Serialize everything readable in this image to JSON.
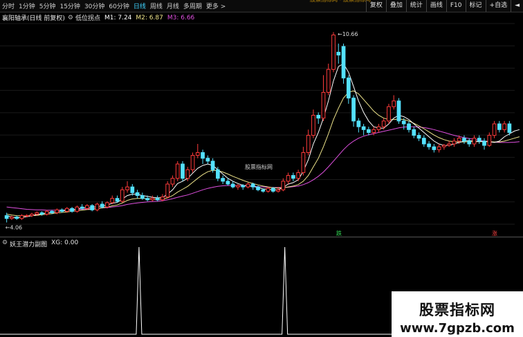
{
  "toolbar": {
    "periods": [
      "分时",
      "1分钟",
      "5分钟",
      "15分钟",
      "30分钟",
      "60分钟",
      "日线",
      "周线",
      "月线",
      "多周期",
      "更多 >"
    ],
    "active_period": "日线",
    "title": "股票指标网 - 股票指标网",
    "right_buttons": [
      "复权",
      "叠加",
      "统计",
      "画线",
      "F10",
      "标记",
      "+自选",
      "◄"
    ]
  },
  "main_legend": {
    "stock_name": "襄阳轴承(日线 前复权)",
    "indicator_name": "低位拐点",
    "m1": "M1: 7.24",
    "m2": "M2: 6.87",
    "m3": "M3: 6.66"
  },
  "sub_legend": {
    "indicator_name": "妖王潜力副图",
    "xg": "XG: 0.00"
  },
  "annotations": {
    "high_label": "10.66",
    "low_label": "4.06",
    "signal_mark_1": "跌",
    "signal_mark_2": "涨"
  },
  "watermark": {
    "mid": "股票指标网",
    "line1": "股票指标网",
    "line2": "www.7gpzb.com"
  },
  "colors": {
    "up": "#ff3b3b",
    "down": "#54e1ff",
    "m1": "#ffffff",
    "m2": "#f0e68c",
    "m3": "#e050e0",
    "active_tab": "#3fd3ff"
  },
  "chart_data": {
    "type": "candlestick",
    "y_range": [
      4.0,
      11.0
    ],
    "high": 10.66,
    "low": 4.06,
    "candles": [
      {
        "o": 4.3,
        "c": 4.2,
        "h": 4.4,
        "l": 4.06
      },
      {
        "o": 4.2,
        "c": 4.25,
        "h": 4.3,
        "l": 4.15
      },
      {
        "o": 4.25,
        "c": 4.2,
        "h": 4.3,
        "l": 4.15
      },
      {
        "o": 4.2,
        "c": 4.3,
        "h": 4.35,
        "l": 4.15
      },
      {
        "o": 4.3,
        "c": 4.3,
        "h": 4.35,
        "l": 4.25
      },
      {
        "o": 4.3,
        "c": 4.35,
        "h": 4.4,
        "l": 4.25
      },
      {
        "o": 4.35,
        "c": 4.4,
        "h": 4.45,
        "l": 4.3
      },
      {
        "o": 4.4,
        "c": 4.35,
        "h": 4.45,
        "l": 4.3
      },
      {
        "o": 4.35,
        "c": 4.45,
        "h": 4.5,
        "l": 4.3
      },
      {
        "o": 4.45,
        "c": 4.4,
        "h": 4.5,
        "l": 4.35
      },
      {
        "o": 4.4,
        "c": 4.5,
        "h": 4.55,
        "l": 4.35
      },
      {
        "o": 4.5,
        "c": 4.45,
        "h": 4.55,
        "l": 4.4
      },
      {
        "o": 4.45,
        "c": 4.55,
        "h": 4.6,
        "l": 4.4
      },
      {
        "o": 4.55,
        "c": 4.45,
        "h": 4.6,
        "l": 4.4
      },
      {
        "o": 4.45,
        "c": 4.6,
        "h": 4.65,
        "l": 4.4
      },
      {
        "o": 4.6,
        "c": 4.55,
        "h": 4.7,
        "l": 4.5
      },
      {
        "o": 4.55,
        "c": 4.65,
        "h": 4.7,
        "l": 4.5
      },
      {
        "o": 4.65,
        "c": 4.5,
        "h": 4.7,
        "l": 4.45
      },
      {
        "o": 4.5,
        "c": 4.7,
        "h": 4.75,
        "l": 4.45
      },
      {
        "o": 4.7,
        "c": 4.6,
        "h": 4.8,
        "l": 4.55
      },
      {
        "o": 4.6,
        "c": 4.75,
        "h": 4.8,
        "l": 4.55
      },
      {
        "o": 4.75,
        "c": 4.9,
        "h": 5.0,
        "l": 4.7
      },
      {
        "o": 4.9,
        "c": 4.8,
        "h": 5.0,
        "l": 4.75
      },
      {
        "o": 4.8,
        "c": 5.2,
        "h": 5.3,
        "l": 4.75
      },
      {
        "o": 5.2,
        "c": 5.3,
        "h": 5.5,
        "l": 5.1
      },
      {
        "o": 5.3,
        "c": 5.1,
        "h": 5.4,
        "l": 5.0
      },
      {
        "o": 5.1,
        "c": 5.0,
        "h": 5.2,
        "l": 4.9
      },
      {
        "o": 5.0,
        "c": 4.9,
        "h": 5.1,
        "l": 4.85
      },
      {
        "o": 4.9,
        "c": 4.85,
        "h": 5.0,
        "l": 4.8
      },
      {
        "o": 4.85,
        "c": 4.9,
        "h": 5.0,
        "l": 4.8
      },
      {
        "o": 4.9,
        "c": 4.85,
        "h": 5.0,
        "l": 4.8
      },
      {
        "o": 4.85,
        "c": 4.95,
        "h": 5.05,
        "l": 4.8
      },
      {
        "o": 4.95,
        "c": 5.4,
        "h": 5.5,
        "l": 4.9
      },
      {
        "o": 5.4,
        "c": 5.6,
        "h": 5.7,
        "l": 5.3
      },
      {
        "o": 5.6,
        "c": 6.1,
        "h": 6.2,
        "l": 5.5
      },
      {
        "o": 6.1,
        "c": 5.6,
        "h": 6.2,
        "l": 5.5
      },
      {
        "o": 5.6,
        "c": 5.9,
        "h": 6.0,
        "l": 5.5
      },
      {
        "o": 5.9,
        "c": 6.4,
        "h": 6.5,
        "l": 5.8
      },
      {
        "o": 6.4,
        "c": 6.5,
        "h": 6.8,
        "l": 6.3
      },
      {
        "o": 6.5,
        "c": 6.3,
        "h": 6.6,
        "l": 6.1
      },
      {
        "o": 6.3,
        "c": 6.2,
        "h": 6.4,
        "l": 6.1
      },
      {
        "o": 6.2,
        "c": 5.9,
        "h": 6.3,
        "l": 5.8
      },
      {
        "o": 5.9,
        "c": 5.6,
        "h": 6.0,
        "l": 5.5
      },
      {
        "o": 5.6,
        "c": 5.5,
        "h": 5.7,
        "l": 5.4
      },
      {
        "o": 5.5,
        "c": 5.4,
        "h": 5.6,
        "l": 5.35
      },
      {
        "o": 5.4,
        "c": 5.3,
        "h": 5.5,
        "l": 5.25
      },
      {
        "o": 5.3,
        "c": 5.35,
        "h": 5.4,
        "l": 5.2
      },
      {
        "o": 5.35,
        "c": 5.3,
        "h": 5.4,
        "l": 5.2
      },
      {
        "o": 5.3,
        "c": 5.4,
        "h": 5.45,
        "l": 5.25
      },
      {
        "o": 5.4,
        "c": 5.3,
        "h": 5.45,
        "l": 5.2
      },
      {
        "o": 5.3,
        "c": 5.2,
        "h": 5.35,
        "l": 5.15
      },
      {
        "o": 5.2,
        "c": 5.15,
        "h": 5.25,
        "l": 5.1
      },
      {
        "o": 5.15,
        "c": 5.25,
        "h": 5.3,
        "l": 5.1
      },
      {
        "o": 5.25,
        "c": 5.15,
        "h": 5.3,
        "l": 5.1
      },
      {
        "o": 5.15,
        "c": 5.2,
        "h": 5.3,
        "l": 5.1
      },
      {
        "o": 5.2,
        "c": 5.5,
        "h": 5.6,
        "l": 5.15
      },
      {
        "o": 5.5,
        "c": 5.7,
        "h": 5.8,
        "l": 5.4
      },
      {
        "o": 5.7,
        "c": 5.6,
        "h": 5.8,
        "l": 5.5
      },
      {
        "o": 5.6,
        "c": 5.8,
        "h": 5.9,
        "l": 5.5
      },
      {
        "o": 5.8,
        "c": 6.5,
        "h": 6.7,
        "l": 5.7
      },
      {
        "o": 6.5,
        "c": 7.1,
        "h": 7.3,
        "l": 6.4
      },
      {
        "o": 7.1,
        "c": 7.8,
        "h": 8.0,
        "l": 7.0
      },
      {
        "o": 7.8,
        "c": 7.7,
        "h": 7.9,
        "l": 7.5
      },
      {
        "o": 7.7,
        "c": 8.6,
        "h": 9.2,
        "l": 7.6
      },
      {
        "o": 8.6,
        "c": 9.4,
        "h": 9.6,
        "l": 8.5
      },
      {
        "o": 9.4,
        "c": 10.6,
        "h": 10.7,
        "l": 9.3
      },
      {
        "o": 10.0,
        "c": 9.9,
        "h": 10.3,
        "l": 9.6
      },
      {
        "o": 10.2,
        "c": 9.1,
        "h": 10.3,
        "l": 8.9
      },
      {
        "o": 9.1,
        "c": 8.4,
        "h": 9.2,
        "l": 8.2
      },
      {
        "o": 8.4,
        "c": 7.6,
        "h": 8.5,
        "l": 7.4
      },
      {
        "o": 7.6,
        "c": 7.4,
        "h": 7.7,
        "l": 7.2
      },
      {
        "o": 7.4,
        "c": 7.3,
        "h": 7.5,
        "l": 7.1
      },
      {
        "o": 7.3,
        "c": 7.2,
        "h": 7.4,
        "l": 7.1
      },
      {
        "o": 7.2,
        "c": 7.3,
        "h": 7.4,
        "l": 7.1
      },
      {
        "o": 7.3,
        "c": 7.4,
        "h": 7.5,
        "l": 7.2
      },
      {
        "o": 7.4,
        "c": 7.6,
        "h": 7.7,
        "l": 7.3
      },
      {
        "o": 7.6,
        "c": 8.1,
        "h": 8.2,
        "l": 7.5
      },
      {
        "o": 8.1,
        "c": 8.3,
        "h": 8.5,
        "l": 8.0
      },
      {
        "o": 8.3,
        "c": 7.6,
        "h": 8.4,
        "l": 7.5
      },
      {
        "o": 7.6,
        "c": 7.5,
        "h": 7.7,
        "l": 7.3
      },
      {
        "o": 7.5,
        "c": 7.3,
        "h": 7.6,
        "l": 7.2
      },
      {
        "o": 7.3,
        "c": 7.1,
        "h": 7.4,
        "l": 7.0
      },
      {
        "o": 7.1,
        "c": 7.0,
        "h": 7.2,
        "l": 6.9
      },
      {
        "o": 7.0,
        "c": 6.8,
        "h": 7.1,
        "l": 6.7
      },
      {
        "o": 6.8,
        "c": 6.7,
        "h": 6.9,
        "l": 6.6
      },
      {
        "o": 6.7,
        "c": 6.6,
        "h": 6.8,
        "l": 6.5
      },
      {
        "o": 6.6,
        "c": 6.7,
        "h": 6.8,
        "l": 6.5
      },
      {
        "o": 6.7,
        "c": 6.75,
        "h": 6.8,
        "l": 6.6
      },
      {
        "o": 6.75,
        "c": 6.8,
        "h": 6.9,
        "l": 6.7
      },
      {
        "o": 6.8,
        "c": 6.9,
        "h": 7.0,
        "l": 6.7
      },
      {
        "o": 6.9,
        "c": 7.0,
        "h": 7.1,
        "l": 6.8
      },
      {
        "o": 7.0,
        "c": 6.9,
        "h": 7.1,
        "l": 6.8
      },
      {
        "o": 6.9,
        "c": 6.8,
        "h": 7.0,
        "l": 6.7
      },
      {
        "o": 6.8,
        "c": 7.0,
        "h": 7.1,
        "l": 6.7
      },
      {
        "o": 7.0,
        "c": 6.9,
        "h": 7.1,
        "l": 6.8
      },
      {
        "o": 6.9,
        "c": 6.75,
        "h": 7.0,
        "l": 6.6
      },
      {
        "o": 6.75,
        "c": 7.1,
        "h": 7.2,
        "l": 6.7
      },
      {
        "o": 7.1,
        "c": 7.5,
        "h": 7.6,
        "l": 7.0
      },
      {
        "o": 7.5,
        "c": 7.3,
        "h": 7.6,
        "l": 7.2
      },
      {
        "o": 7.3,
        "c": 7.5,
        "h": 7.6,
        "l": 7.2
      },
      {
        "o": 7.5,
        "c": 7.2,
        "h": 7.6,
        "l": 7.1
      }
    ],
    "m1": [
      4.3,
      4.25,
      4.22,
      4.24,
      4.26,
      4.3,
      4.33,
      4.36,
      4.39,
      4.41,
      4.44,
      4.46,
      4.49,
      4.5,
      4.53,
      4.56,
      4.58,
      4.58,
      4.62,
      4.63,
      4.67,
      4.73,
      4.76,
      4.88,
      5.0,
      5.05,
      5.04,
      5.0,
      4.97,
      4.94,
      4.92,
      4.93,
      5.05,
      5.2,
      5.42,
      5.5,
      5.6,
      5.78,
      5.95,
      6.05,
      6.1,
      6.05,
      5.9,
      5.75,
      5.6,
      5.5,
      5.42,
      5.36,
      5.34,
      5.32,
      5.28,
      5.23,
      5.22,
      5.2,
      5.2,
      5.28,
      5.4,
      5.45,
      5.55,
      5.85,
      6.25,
      6.8,
      7.2,
      7.7,
      8.3,
      9.0,
      9.5,
      9.6,
      9.3,
      8.8,
      8.3,
      7.9,
      7.6,
      7.4,
      7.35,
      7.35,
      7.5,
      7.7,
      7.8,
      7.75,
      7.65,
      7.5,
      7.35,
      7.2,
      7.05,
      6.9,
      6.8,
      6.75,
      6.75,
      6.8,
      6.85,
      6.9,
      6.92,
      6.9,
      6.88,
      6.9,
      6.88,
      6.85,
      6.9,
      7.05,
      7.15,
      7.25,
      7.3
    ],
    "m2": [
      4.35,
      4.32,
      4.3,
      4.29,
      4.29,
      4.3,
      4.31,
      4.33,
      4.35,
      4.37,
      4.39,
      4.41,
      4.43,
      4.45,
      4.47,
      4.49,
      4.51,
      4.52,
      4.55,
      4.57,
      4.6,
      4.64,
      4.67,
      4.74,
      4.83,
      4.88,
      4.9,
      4.9,
      4.89,
      4.88,
      4.87,
      4.87,
      4.92,
      5.0,
      5.12,
      5.22,
      5.32,
      5.46,
      5.6,
      5.73,
      5.83,
      5.88,
      5.87,
      5.82,
      5.75,
      5.67,
      5.6,
      5.53,
      5.47,
      5.42,
      5.37,
      5.33,
      5.3,
      5.27,
      5.26,
      5.27,
      5.3,
      5.33,
      5.38,
      5.5,
      5.7,
      6.0,
      6.3,
      6.7,
      7.15,
      7.65,
      8.05,
      8.4,
      8.6,
      8.65,
      8.55,
      8.35,
      8.15,
      7.95,
      7.8,
      7.7,
      7.65,
      7.65,
      7.67,
      7.65,
      7.6,
      7.52,
      7.43,
      7.33,
      7.22,
      7.11,
      7.02,
      6.95,
      6.9,
      6.88,
      6.87,
      6.87,
      6.88,
      6.88,
      6.88,
      6.88,
      6.88,
      6.87,
      6.87,
      6.9,
      6.95,
      7.0,
      7.05
    ],
    "m3": [
      4.6,
      4.58,
      4.56,
      4.54,
      4.52,
      4.51,
      4.5,
      4.5,
      4.49,
      4.49,
      4.49,
      4.49,
      4.5,
      4.5,
      4.51,
      4.52,
      4.53,
      4.54,
      4.55,
      4.57,
      4.58,
      4.6,
      4.62,
      4.65,
      4.69,
      4.72,
      4.74,
      4.76,
      4.78,
      4.79,
      4.8,
      4.82,
      4.85,
      4.89,
      4.94,
      4.98,
      5.02,
      5.08,
      5.14,
      5.2,
      5.25,
      5.29,
      5.32,
      5.34,
      5.35,
      5.35,
      5.35,
      5.34,
      5.33,
      5.32,
      5.31,
      5.3,
      5.29,
      5.28,
      5.28,
      5.28,
      5.29,
      5.31,
      5.33,
      5.38,
      5.45,
      5.55,
      5.67,
      5.82,
      6.0,
      6.2,
      6.4,
      6.6,
      6.77,
      6.9,
      7.0,
      7.07,
      7.12,
      7.16,
      7.2,
      7.24,
      7.28,
      7.32,
      7.36,
      7.39,
      7.4,
      7.4,
      7.39,
      7.37,
      7.34,
      7.3,
      7.25,
      7.2,
      7.15,
      7.1,
      7.06,
      7.02,
      6.99,
      6.96,
      6.93,
      6.9,
      6.88,
      6.86,
      6.85,
      6.85,
      6.85,
      6.86,
      6.88
    ],
    "sub_signal": {
      "type": "line",
      "peaks_at_index": [
        31,
        60
      ],
      "peak_value": 1,
      "base_value": 0
    }
  }
}
